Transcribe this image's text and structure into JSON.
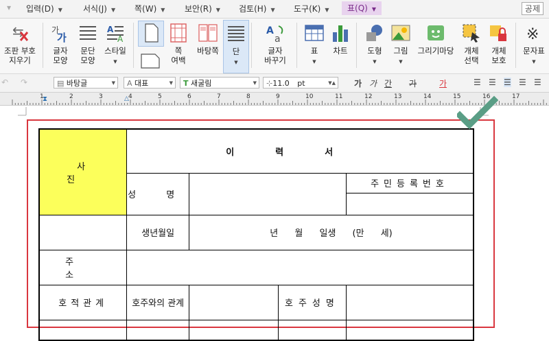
{
  "menubar": {
    "items": [
      "입력(D)",
      "서식(J)",
      "쪽(W)",
      "보안(R)",
      "검토(H)",
      "도구(K)",
      "표(Q)"
    ],
    "tail": "공제"
  },
  "ribbon": {
    "buttons": [
      {
        "label": "조판 부호\n지우기",
        "icon": "clear-marks-icon"
      },
      {
        "label": "글자\n모양",
        "icon": "char-shape-icon"
      },
      {
        "label": "문단\n모양",
        "icon": "para-shape-icon"
      },
      {
        "label": "스타일",
        "icon": "style-icon"
      },
      {
        "label": "쪽\n여백",
        "icon": "page-margin-icon"
      },
      {
        "label": "바탕쪽",
        "icon": "master-page-icon"
      },
      {
        "label": "단",
        "icon": "columns-icon"
      },
      {
        "label": "글자\n바꾸기",
        "icon": "change-char-icon"
      },
      {
        "label": "표",
        "icon": "table-icon"
      },
      {
        "label": "차트",
        "icon": "chart-icon"
      },
      {
        "label": "도형",
        "icon": "shape-icon"
      },
      {
        "label": "그림",
        "icon": "picture-icon"
      },
      {
        "label": "그리기마당",
        "icon": "clipart-icon"
      },
      {
        "label": "개체\n선택",
        "icon": "object-select-icon"
      },
      {
        "label": "개체\n보호",
        "icon": "object-protect-icon"
      },
      {
        "label": "문자표",
        "icon": "symbol-icon"
      }
    ]
  },
  "format": {
    "style_combo": "바탕글",
    "lang_combo": "대표",
    "font_combo": "새굴림",
    "size_value": "11.0",
    "size_unit": "pt",
    "bold": "가",
    "italic": "가",
    "underline": "간",
    "strike": "가",
    "color": "가"
  },
  "ruler": {
    "numbers": [
      "1",
      "2",
      "3",
      "4",
      "5",
      "6",
      "7",
      "8",
      "9",
      "10",
      "11",
      "12",
      "13",
      "14",
      "15",
      "16",
      "17"
    ]
  },
  "resume": {
    "title": "이력서",
    "photo": "사 진",
    "name_label": "성 명",
    "id_label": "주민등록번호",
    "birth_label": "생년월일",
    "birth_value": "년 월 일생 (만 세)",
    "address_label": "주 소",
    "family_label": "호적관계",
    "relation_label": "호주와의 관계",
    "head_name_label": "호주성명"
  },
  "colors": {
    "photo_bg": "#fcff5b",
    "check": "#5a9e86",
    "frame": "#d9363e",
    "active_menu": "#7a2c8a"
  }
}
